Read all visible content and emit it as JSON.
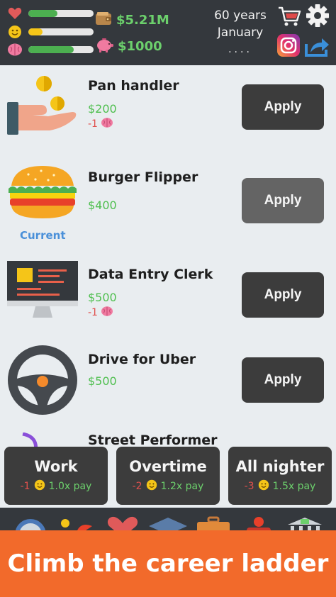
{
  "stats": {
    "health": {
      "icon": "heart-icon",
      "level": 0.45,
      "color": "#4caf50"
    },
    "happiness": {
      "icon": "smiley-icon",
      "level": 0.22,
      "color": "#f5c518"
    },
    "smarts": {
      "icon": "brain-icon",
      "level": 0.7,
      "color": "#4caf50"
    }
  },
  "money": {
    "net_worth": "$5.21M",
    "cash": "$1000"
  },
  "age": {
    "years": "60 years",
    "month": "January",
    "dots": "...."
  },
  "jobs": [
    {
      "title": "Pan handler",
      "pay": "$200",
      "cost": "-1",
      "button": "Apply",
      "icon": "hand-coins-icon"
    },
    {
      "title": "Burger Flipper",
      "pay": "$400",
      "current_label": "Current",
      "button": "Apply",
      "icon": "burger-icon"
    },
    {
      "title": "Data Entry Clerk",
      "pay": "$500",
      "cost": "-1",
      "button": "Apply",
      "icon": "computer-monitor-icon"
    },
    {
      "title": "Drive for Uber",
      "pay": "$500",
      "button": "Apply",
      "icon": "steering-wheel-icon"
    },
    {
      "title": "Street Performer",
      "icon": "performer-icon"
    }
  ],
  "shifts": [
    {
      "title": "Work",
      "cost": "-1",
      "mult": "1.0x pay"
    },
    {
      "title": "Overtime",
      "cost": "-2",
      "mult": "1.2x pay"
    },
    {
      "title": "All nighter",
      "cost": "-3",
      "mult": "1.5x pay"
    }
  ],
  "banner": "Climb the career ladder",
  "colors": {
    "accent_orange": "#f26a2b",
    "money_green": "#6cd06c",
    "cost_red": "#e0504d",
    "current_blue": "#4a90d9"
  }
}
